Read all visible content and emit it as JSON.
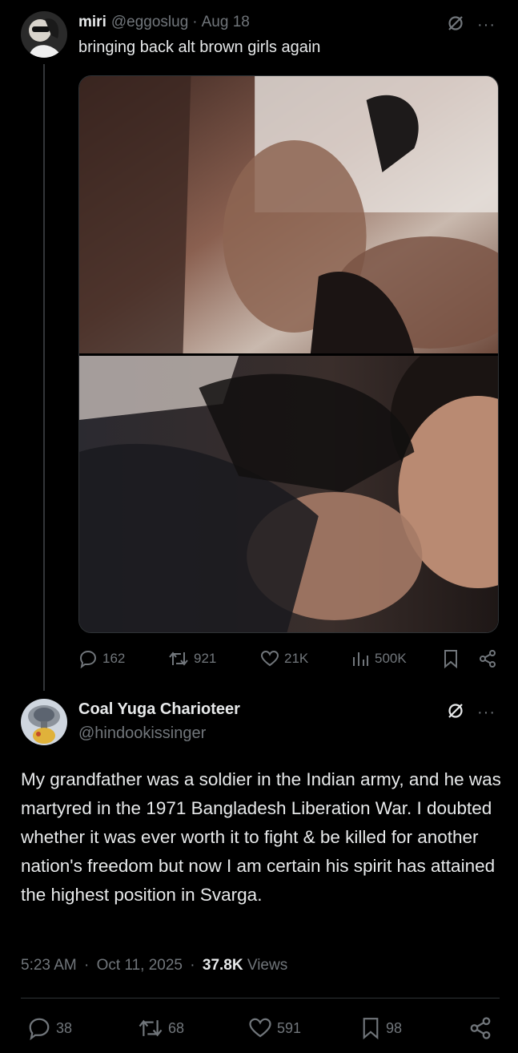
{
  "quoted_post": {
    "display_name": "miri",
    "handle": "@eggoslug",
    "separator": "·",
    "date": "Aug 18",
    "text": "bringing back alt brown girls again",
    "stats": {
      "replies": "162",
      "reposts": "921",
      "likes": "21K",
      "views": "500K"
    }
  },
  "main_post": {
    "display_name": "Coal Yuga Charioteer",
    "handle": "@hindookissinger",
    "text": "My grandfather was a soldier in the Indian army, and he was martyred in the 1971 Bangladesh Liberation War. I doubted whether it was ever worth it to fight & be killed for another nation's freedom but now I am certain his spirit has attained the highest position in Svarga.",
    "time": "5:23 AM",
    "date": "Oct 11, 2025",
    "views_count": "37.8K",
    "views_label": "Views",
    "sep": "·",
    "stats": {
      "replies": "38",
      "reposts": "68",
      "likes": "591",
      "bookmarks": "98"
    }
  },
  "icons": {
    "more": "more-dots-icon",
    "grok": "grok-icon",
    "reply": "reply-bubble-icon",
    "repost": "repost-icon",
    "like": "heart-icon",
    "views": "bar-chart-icon",
    "bookmark": "bookmark-icon",
    "share": "share-icon"
  },
  "colors": {
    "background": "#000000",
    "text": "#e7e9ea",
    "muted": "#71767b",
    "border": "#2f3336"
  }
}
